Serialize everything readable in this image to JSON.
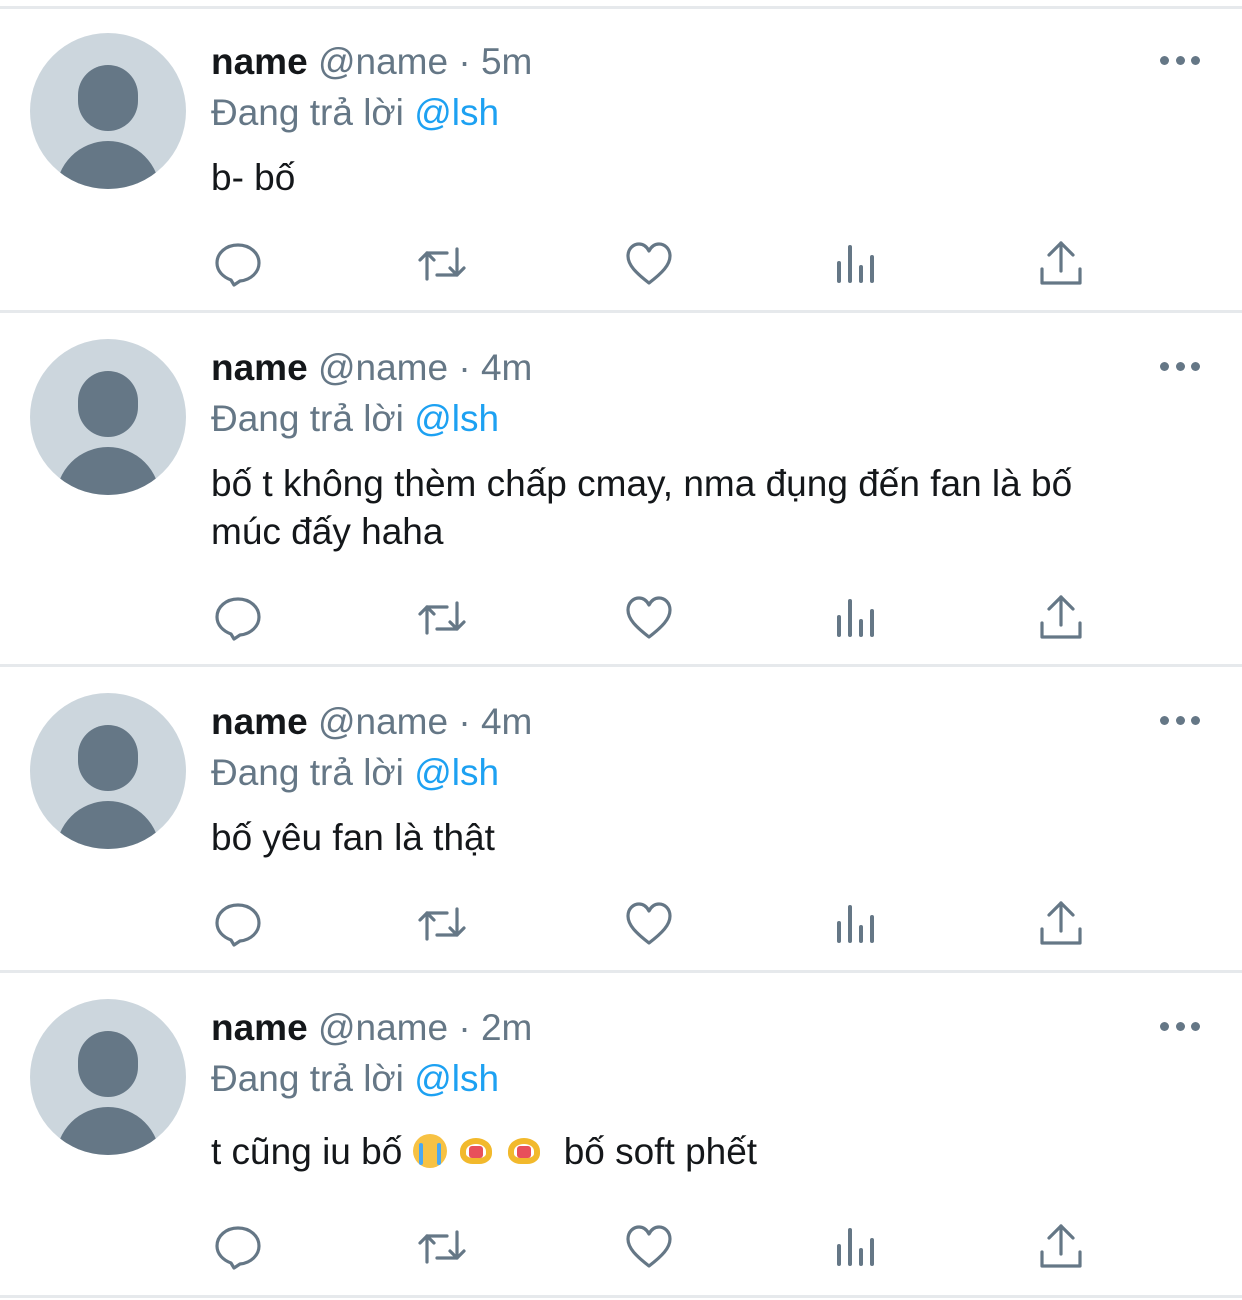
{
  "tweets": [
    {
      "display_name": "name",
      "handle": "@name",
      "time": "5m",
      "reply_prefix": "Đang trả lời",
      "reply_to": "@lsh",
      "text": "b- bố"
    },
    {
      "display_name": "name",
      "handle": "@name",
      "time": "4m",
      "reply_prefix": "Đang trả lời",
      "reply_to": "@lsh",
      "text_line1": "bố t không thèm chấp cmay, nma đụng đến fan là bố",
      "text_line2": "múc đấy haha"
    },
    {
      "display_name": "name",
      "handle": "@name",
      "time": "4m",
      "reply_prefix": "Đang trả lời",
      "reply_to": "@lsh",
      "text": "bố yêu fan là thật"
    },
    {
      "display_name": "name",
      "handle": "@name",
      "time": "2m",
      "reply_prefix": "Đang trả lời",
      "reply_to": "@lsh",
      "text_before": "t cũng iu bố",
      "emojis": [
        "loudly-crying-face",
        "heart-hands",
        "heart-hands"
      ],
      "text_after": "bố soft phết"
    }
  ],
  "colors": {
    "secondary_text": "#657786",
    "mention": "#1da1f2",
    "avatar_bg": "#ccd6dd",
    "divider": "#e6e9ec"
  },
  "action_icons": [
    "reply-icon",
    "retweet-icon",
    "like-icon",
    "analytics-icon",
    "share-icon"
  ]
}
